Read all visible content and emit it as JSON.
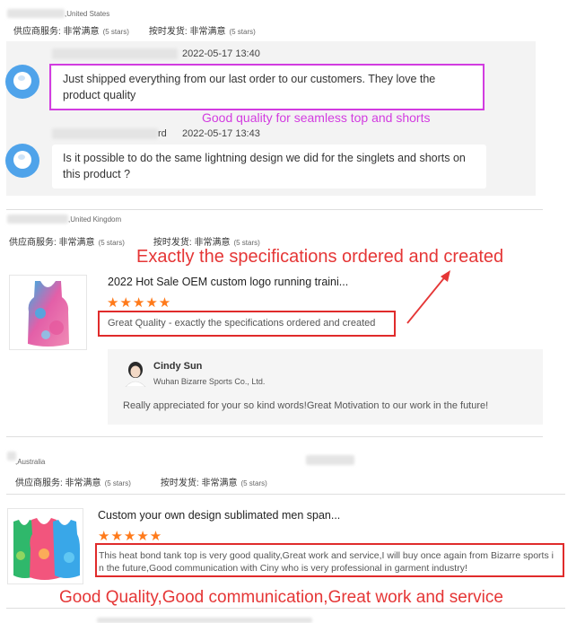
{
  "review1": {
    "country": ",United States",
    "service_label": "供应商服务: 非常满意",
    "service_stars": "(5 stars)",
    "ship_label": "按时发货: 非常满意",
    "ship_stars": "(5 stars)",
    "messages": [
      {
        "timestamp": "2022-05-17 13:40",
        "text": "Just shipped everything from our last order to our customers. They love the product quality"
      },
      {
        "sender_suffix": "rd",
        "timestamp": "2022-05-17 13:43",
        "text": "Is it possible to do the same lightning design we did for the singlets and shorts on this product ?"
      }
    ],
    "annotation": "Good quality for seamless top and shorts"
  },
  "review2": {
    "country": ",United Kingdom",
    "service_label": "供应商服务: 非常满意",
    "service_stars": "(5 stars)",
    "ship_label": "按时发货: 非常满意",
    "ship_stars": "(5 stars)",
    "annotation": "Exactly the specifications ordered and created",
    "product_title": "2022 Hot Sale OEM custom logo running traini...",
    "stars": "★★★★★",
    "review_text": "Great Quality - exactly the specifications ordered and created",
    "reply": {
      "name": "Cindy Sun",
      "company": "Wuhan Bizarre Sports Co., Ltd.",
      "text": "Really appreciated for your so kind words!Great Motivation to our work in the future!"
    }
  },
  "review3": {
    "country": ",Australia",
    "service_label": "供应商服务: 非常满意",
    "service_stars": "(5 stars)",
    "ship_label": "按时发货: 非常满意",
    "ship_stars": "(5 stars)",
    "product_title": "Custom your own design sublimated men span...",
    "stars": "★★★★★",
    "review_text": "This heat bond tank top is very good quality,Great work and service,I will buy once again from Bizarre sports in the future,Good  communication with Ciny who is very professional in garment industry!",
    "annotation": "Good Quality,Good communication,Great work and service"
  },
  "colors": {
    "annotation_magenta": "#d23ce0",
    "annotation_red": "#e02b2b",
    "star_orange": "#ff7a1a",
    "avatar_blue": "#4fa3ea"
  }
}
